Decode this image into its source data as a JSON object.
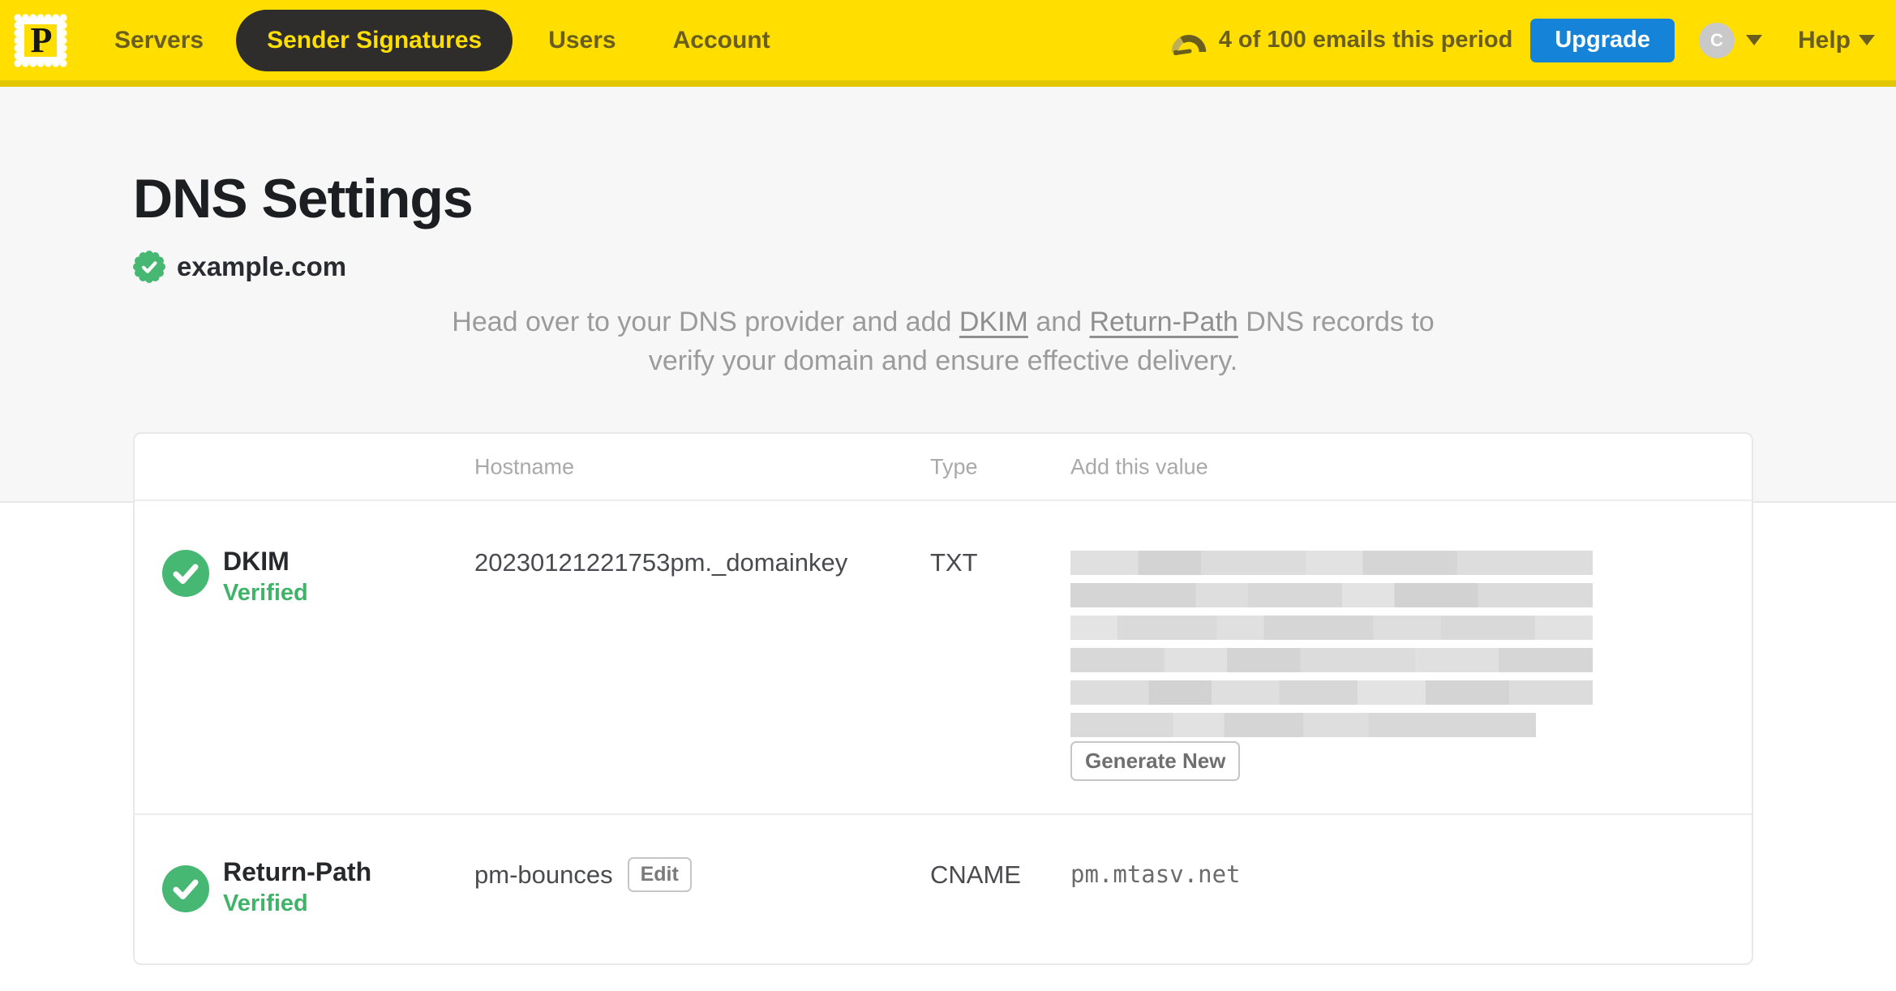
{
  "colors": {
    "brand_yellow": "#ffde00",
    "nav_text_olive": "#6a5e1d",
    "upgrade_blue": "#1583d7",
    "verified_green": "#3fb468",
    "upper_band_gray": "#f7f7f8"
  },
  "nav": {
    "logo_letter": "P",
    "items": [
      {
        "label": "Servers",
        "active": false
      },
      {
        "label": "Sender Signatures",
        "active": true
      },
      {
        "label": "Users",
        "active": false
      },
      {
        "label": "Account",
        "active": false
      }
    ],
    "usage_text": "4 of 100 emails this period",
    "upgrade_label": "Upgrade",
    "avatar_letter": "C",
    "help_label": "Help"
  },
  "page": {
    "title": "DNS Settings",
    "domain_name": "example.com",
    "description": {
      "p1": "Head over to your DNS provider and add ",
      "link_dkim": "DKIM",
      "p2": " and ",
      "link_return_path": "Return-Path",
      "p3": " DNS records to",
      "line2": "verify your domain and ensure effective delivery."
    }
  },
  "table": {
    "headers": {
      "hostname": "Hostname",
      "type": "Type",
      "value": "Add this value"
    },
    "rows": [
      {
        "name": "DKIM",
        "status": "Verified",
        "hostname": "20230121221753pm._domainkey",
        "type": "TXT",
        "value_redacted": true,
        "action_label": "Generate New"
      },
      {
        "name": "Return-Path",
        "status": "Verified",
        "hostname": "pm-bounces",
        "edit_label": "Edit",
        "type": "CNAME",
        "value": "pm.mtasv.net"
      }
    ]
  }
}
